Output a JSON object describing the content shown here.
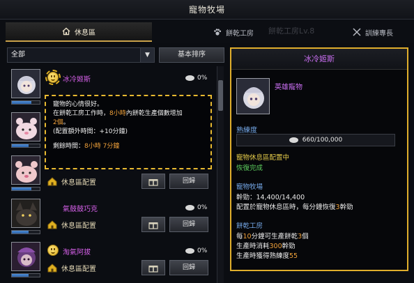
{
  "window": {
    "title": "寵物牧場"
  },
  "tabs": [
    {
      "label": "休息區"
    },
    {
      "label": "餅乾工房"
    },
    {
      "label": "訓練專長"
    }
  ],
  "background_text": "餅乾工房Lv.8",
  "filter": {
    "selected": "全部",
    "sort_label": "基本排序"
  },
  "pets": [
    {
      "name": "冰冷姬斯",
      "percent": "0%",
      "status": "",
      "gift_label": "",
      "recall_label": "",
      "mood": "happy",
      "xp_fill": 0.7
    },
    {
      "name": "",
      "percent": "",
      "status": "",
      "gift_label": "",
      "recall_label": "",
      "mood": "",
      "xp_fill": 0.6
    },
    {
      "name": "",
      "percent": "",
      "status": "休息區配置",
      "gift_label": "",
      "recall_label": "回歸",
      "mood": "",
      "xp_fill": 0.7
    },
    {
      "name": "氣鼓鼓巧克",
      "percent": "0%",
      "status": "休息區配置",
      "gift_label": "",
      "recall_label": "回歸",
      "mood": "",
      "xp_fill": 0.6
    },
    {
      "name": "淘氣阿拔",
      "percent": "0%",
      "status": "休息區配置",
      "gift_label": "",
      "recall_label": "回歸",
      "mood": "happy",
      "xp_fill": 0.6
    }
  ],
  "tooltip": {
    "line1": "寵物的心情很好。",
    "line2_a": "在餅乾工房工作時，",
    "line2_hl": "8小時",
    "line2_b": "內餅乾生產個數增加",
    "line3_hl": "2個",
    "line3_b": "。",
    "line4": "(配置額外時間：+10分鐘)",
    "remain_label": "剩餘時間：",
    "remain_value": "8小時 7分鐘"
  },
  "detail": {
    "title": "冰冷姬斯",
    "grade": "英雄寵物",
    "xp_label": "熟練度",
    "xp_value": "660/100,000",
    "rest_label": "寵物休息區配置中",
    "rest_status": "恢復完成",
    "ranch_label": "寵物牧場",
    "stamina": "幹勁：14,400/14,400",
    "rest_recover_a": "配置於寵物休息區時，每分鐘恢復",
    "rest_recover_n": "3",
    "rest_recover_b": "幹勁",
    "workshop_label": "餅乾工房",
    "w1_a": "每",
    "w1_n1": "10",
    "w1_b": "分鐘可生產餅乾",
    "w1_n2": "3",
    "w1_c": "個",
    "w2_a": "生產時消耗",
    "w2_n": "300",
    "w2_b": "幹勁",
    "w3_a": "生產時獲得熟練度",
    "w3_n": "55"
  },
  "colors": {
    "accent_gold": "#e0ae2c",
    "name_purple": "#d35fe6",
    "label_blue": "#75a8e8",
    "highlight_orange": "#f0a13a",
    "status_green": "#5fd15f"
  }
}
